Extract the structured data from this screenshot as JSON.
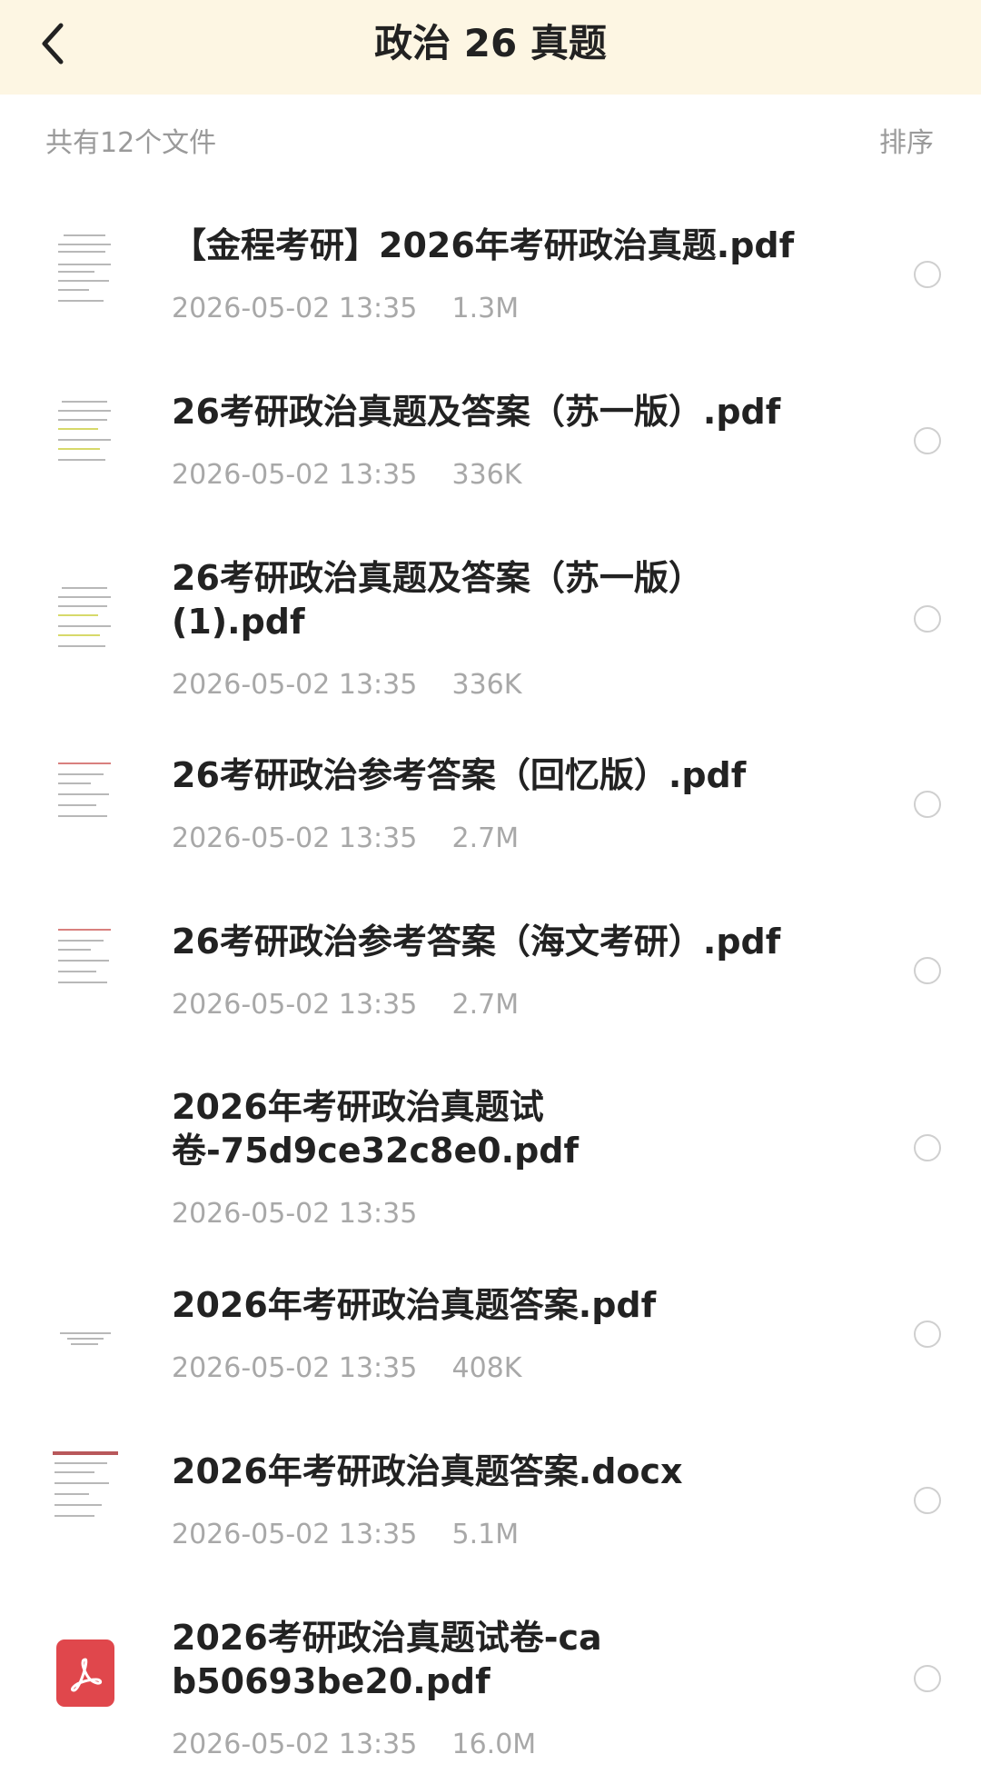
{
  "header": {
    "title": "政治 26 真题",
    "back_icon": "chevron-left-icon"
  },
  "summary": {
    "count_text": "共有12个文件",
    "sort_label": "排序"
  },
  "files": [
    {
      "name": "【金程考研】2026年考研政治真题.pdf",
      "date": "2026-05-02 13:35",
      "size": "1.3M",
      "thumb": "document-thumbnail"
    },
    {
      "name": "26考研政治真题及答案（苏一版）.pdf",
      "date": "2026-05-02 13:35",
      "size": "336K",
      "thumb": "document-thumbnail"
    },
    {
      "name": "26考研政治真题及答案（苏一版）(1).pdf",
      "date": "2026-05-02 13:35",
      "size": "336K",
      "thumb": "document-thumbnail"
    },
    {
      "name": "26考研政治参考答案（回忆版）.pdf",
      "date": "2026-05-02 13:35",
      "size": "2.7M",
      "thumb": "document-thumbnail"
    },
    {
      "name": "26考研政治参考答案（海文考研）.pdf",
      "date": "2026-05-02 13:35",
      "size": "2.7M",
      "thumb": "document-thumbnail"
    },
    {
      "name": "2026年考研政治真题试卷-75d9ce32c8e0.pdf",
      "date": "2026-05-02 13:35",
      "size": "",
      "thumb": "none"
    },
    {
      "name": "2026年考研政治真题答案.pdf",
      "date": "2026-05-02 13:35",
      "size": "408K",
      "thumb": "document-thumbnail"
    },
    {
      "name": "2026年考研政治真题答案.docx",
      "date": "2026-05-02 13:35",
      "size": "5.1M",
      "thumb": "document-thumbnail"
    },
    {
      "name": "2026考研政治真题试卷-cab50693be20.pdf",
      "date": "2026-05-02 13:35",
      "size": "16.0M",
      "thumb": "pdf-icon"
    }
  ],
  "colors": {
    "header_bg": "#fdf6e3",
    "pdf_icon": "#e0474c",
    "meta_text": "#a8a8a8"
  }
}
